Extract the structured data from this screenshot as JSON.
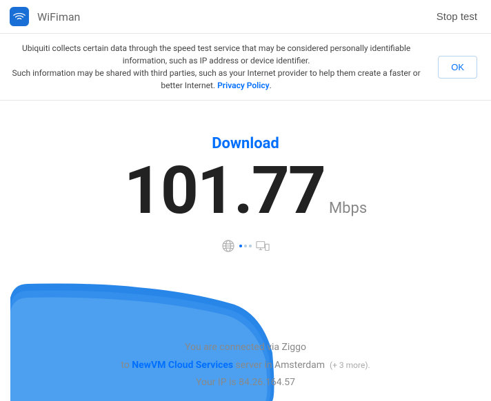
{
  "header": {
    "app_title": "WiFiman",
    "stop_test": "Stop test"
  },
  "notice": {
    "line1": "Ubiquiti collects certain data through the speed test service that may be considered personally identifiable information, such as IP address or device identifier.",
    "line2_prefix": "Such information may be shared with third parties, such as your Internet provider to help them create a faster or better Internet. ",
    "privacy_link": "Privacy Policy",
    "period": ".",
    "ok": "OK"
  },
  "speed": {
    "label": "Download",
    "value": "101.77",
    "unit": "Mbps"
  },
  "footer": {
    "connected_prefix": "You are connected via ",
    "isp": "Ziggo",
    "to_prefix": "to ",
    "server": "NewVM Cloud Services",
    "server_suffix": " server in ",
    "location": "Amsterdam",
    "more": "(+ 3 more)",
    "more_period": ".",
    "ip_prefix": "Your IP is ",
    "ip": "84.26.164.57"
  }
}
